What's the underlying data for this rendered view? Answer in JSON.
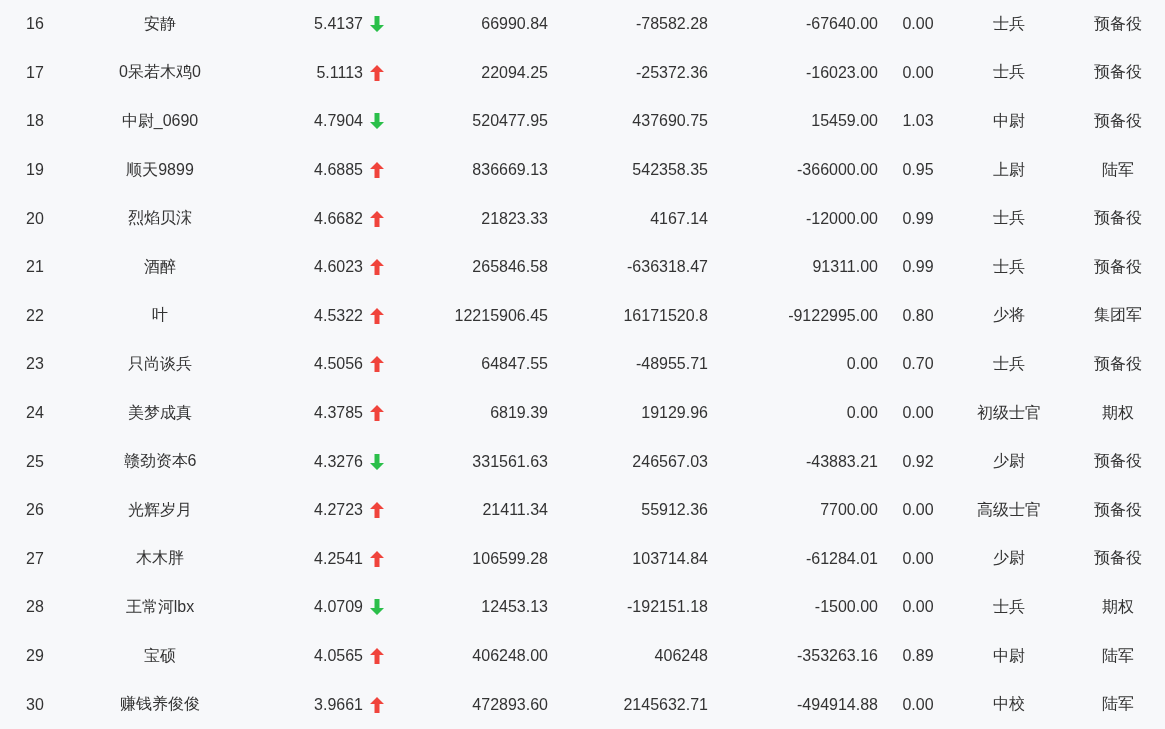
{
  "rows": [
    {
      "rank": "16",
      "name": "安静",
      "score": "5.4137",
      "rising": false,
      "col4": "66990.84",
      "col5": "-78582.28",
      "col6": "-67640.00",
      "col7": "0.00",
      "rank_title": "士兵",
      "group": "预备役"
    },
    {
      "rank": "17",
      "name": "0呆若木鸡0",
      "score": "5.1113",
      "rising": true,
      "col4": "22094.25",
      "col5": "-25372.36",
      "col6": "-16023.00",
      "col7": "0.00",
      "rank_title": "士兵",
      "group": "预备役"
    },
    {
      "rank": "18",
      "name": "中尉_0690",
      "score": "4.7904",
      "rising": false,
      "col4": "520477.95",
      "col5": "437690.75",
      "col6": "15459.00",
      "col7": "1.03",
      "rank_title": "中尉",
      "group": "预备役"
    },
    {
      "rank": "19",
      "name": "顺天9899",
      "score": "4.6885",
      "rising": true,
      "col4": "836669.13",
      "col5": "542358.35",
      "col6": "-366000.00",
      "col7": "0.95",
      "rank_title": "上尉",
      "group": "陆军"
    },
    {
      "rank": "20",
      "name": "烈焰贝浨",
      "score": "4.6682",
      "rising": true,
      "col4": "21823.33",
      "col5": "4167.14",
      "col6": "-12000.00",
      "col7": "0.99",
      "rank_title": "士兵",
      "group": "预备役"
    },
    {
      "rank": "21",
      "name": "酒醉",
      "score": "4.6023",
      "rising": true,
      "col4": "265846.58",
      "col5": "-636318.47",
      "col6": "91311.00",
      "col7": "0.99",
      "rank_title": "士兵",
      "group": "预备役"
    },
    {
      "rank": "22",
      "name": "叶",
      "score": "4.5322",
      "rising": true,
      "col4": "12215906.45",
      "col5": "16171520.8",
      "col6": "-9122995.00",
      "col7": "0.80",
      "rank_title": "少将",
      "group": "集团军"
    },
    {
      "rank": "23",
      "name": "只尚谈兵",
      "score": "4.5056",
      "rising": true,
      "col4": "64847.55",
      "col5": "-48955.71",
      "col6": "0.00",
      "col7": "0.70",
      "rank_title": "士兵",
      "group": "预备役"
    },
    {
      "rank": "24",
      "name": "美梦成真",
      "score": "4.3785",
      "rising": true,
      "col4": "6819.39",
      "col5": "19129.96",
      "col6": "0.00",
      "col7": "0.00",
      "rank_title": "初级士官",
      "group": "期权"
    },
    {
      "rank": "25",
      "name": "赣劲资本6",
      "score": "4.3276",
      "rising": false,
      "col4": "331561.63",
      "col5": "246567.03",
      "col6": "-43883.21",
      "col7": "0.92",
      "rank_title": "少尉",
      "group": "预备役"
    },
    {
      "rank": "26",
      "name": "光辉岁月",
      "score": "4.2723",
      "rising": true,
      "col4": "21411.34",
      "col5": "55912.36",
      "col6": "7700.00",
      "col7": "0.00",
      "rank_title": "高级士官",
      "group": "预备役"
    },
    {
      "rank": "27",
      "name": "木木胖",
      "score": "4.2541",
      "rising": true,
      "col4": "106599.28",
      "col5": "103714.84",
      "col6": "-61284.01",
      "col7": "0.00",
      "rank_title": "少尉",
      "group": "预备役"
    },
    {
      "rank": "28",
      "name": "王常河lbx",
      "score": "4.0709",
      "rising": false,
      "col4": "12453.13",
      "col5": "-192151.18",
      "col6": "-1500.00",
      "col7": "0.00",
      "rank_title": "士兵",
      "group": "期权"
    },
    {
      "rank": "29",
      "name": "宝硕",
      "score": "4.0565",
      "rising": true,
      "col4": "406248.00",
      "col5": "406248",
      "col6": "-353263.16",
      "col7": "0.89",
      "rank_title": "中尉",
      "group": "陆军"
    },
    {
      "rank": "30",
      "name": "赚钱养俊俊",
      "score": "3.9661",
      "rising": true,
      "col4": "472893.60",
      "col5": "2145632.71",
      "col6": "-494914.88",
      "col7": "0.00",
      "rank_title": "中校",
      "group": "陆军"
    }
  ]
}
